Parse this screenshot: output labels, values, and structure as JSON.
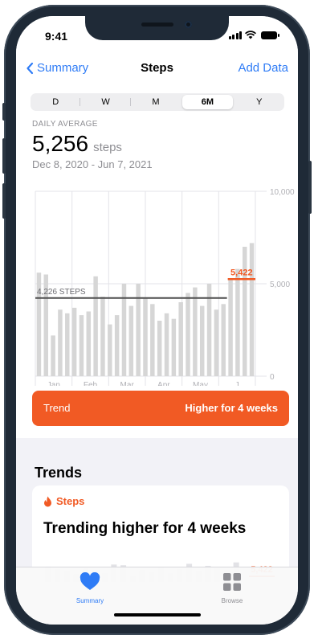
{
  "status_bar": {
    "time": "9:41"
  },
  "nav": {
    "back_label": "Summary",
    "title": "Steps",
    "action_label": "Add Data"
  },
  "segments": {
    "items": [
      "D",
      "W",
      "M",
      "6M",
      "Y"
    ],
    "selected": "6M"
  },
  "summary": {
    "daily_average_label": "DAILY AVERAGE",
    "average_value": "5,256",
    "average_unit": "steps",
    "date_range": "Dec 8, 2020 - Jun 7, 2021"
  },
  "chart_data": {
    "type": "bar",
    "x_tick_labels": [
      "Jan",
      "Feb",
      "Mar",
      "Apr",
      "May",
      "J"
    ],
    "y_tick_labels": [
      "10,000",
      "5,000",
      "0"
    ],
    "ylim": [
      0,
      10000
    ],
    "values": [
      5600,
      5500,
      2200,
      3600,
      3400,
      3700,
      3300,
      3500,
      5400,
      4300,
      2800,
      3300,
      5000,
      3800,
      5000,
      4200,
      3900,
      3000,
      3400,
      3100,
      4000,
      4500,
      4800,
      3800,
      5000,
      3600,
      3900,
      5300,
      5800,
      7000,
      7200
    ],
    "average_line": {
      "value": 4226,
      "label": "4,226 STEPS",
      "color": "#4d4d4d"
    },
    "trend_line": {
      "value": 5422,
      "label": "5,422",
      "color": "#f15a24"
    },
    "bar_color": "#d6d6d6",
    "grid": true
  },
  "trend_banner": {
    "label": "Trend",
    "value": "Higher for 4 weeks",
    "color": "#f15a24"
  },
  "trends_section": {
    "heading": "Trends",
    "card": {
      "category_label": "Steps",
      "category_icon": "flame-icon",
      "title": "Trending higher for 4 weeks",
      "mini_chart_values": [
        2200,
        1800,
        1500,
        1100,
        1900,
        1600,
        1300,
        2500,
        2400,
        900,
        1700,
        1400,
        2100,
        1200,
        1800,
        2600,
        1500,
        2300,
        2000,
        1700,
        2800
      ],
      "mini_chart_label": "5,422"
    }
  },
  "tabbar": {
    "items": [
      {
        "label": "Summary",
        "icon": "heart-icon",
        "active": true,
        "color": "#2f7cf6"
      },
      {
        "label": "Browse",
        "icon": "grid-icon",
        "active": false,
        "color": "#8e8e93"
      }
    ]
  }
}
